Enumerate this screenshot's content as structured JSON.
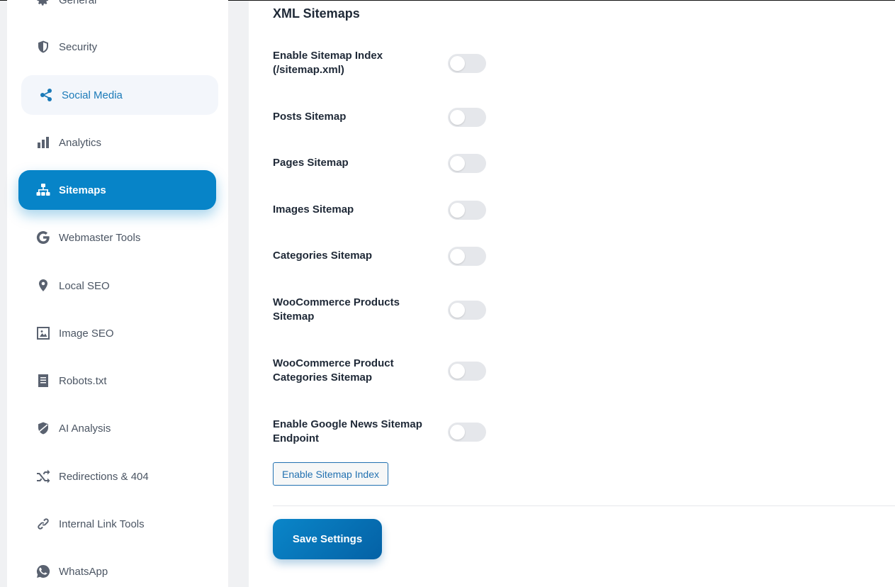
{
  "sidebar": {
    "items": [
      {
        "label": "General",
        "icon": "gear-icon",
        "state": "normal"
      },
      {
        "label": "Security",
        "icon": "shield-icon",
        "state": "normal"
      },
      {
        "label": "Social Media",
        "icon": "share-icon",
        "state": "hover"
      },
      {
        "label": "Analytics",
        "icon": "bar-chart-icon",
        "state": "normal"
      },
      {
        "label": "Sitemaps",
        "icon": "sitemap-icon",
        "state": "active"
      },
      {
        "label": "Webmaster Tools",
        "icon": "google-icon",
        "state": "normal"
      },
      {
        "label": "Local SEO",
        "icon": "map-pin-icon",
        "state": "normal"
      },
      {
        "label": "Image SEO",
        "icon": "image-icon",
        "state": "normal"
      },
      {
        "label": "Robots.txt",
        "icon": "document-icon",
        "state": "normal"
      },
      {
        "label": "AI Analysis",
        "icon": "ai-shield-icon",
        "state": "normal"
      },
      {
        "label": "Redirections & 404",
        "icon": "shuffle-icon",
        "state": "normal"
      },
      {
        "label": "Internal Link Tools",
        "icon": "link-icon",
        "state": "normal"
      },
      {
        "label": "WhatsApp",
        "icon": "whatsapp-icon",
        "state": "normal"
      }
    ]
  },
  "main": {
    "title": "XML Sitemaps",
    "settings": [
      {
        "label_line1": "Enable Sitemap Index",
        "label_line2": "(/sitemap.xml)",
        "enabled": false
      },
      {
        "label_line1": "Posts Sitemap",
        "label_line2": "",
        "enabled": false
      },
      {
        "label_line1": "Pages Sitemap",
        "label_line2": "",
        "enabled": false
      },
      {
        "label_line1": "Images Sitemap",
        "label_line2": "",
        "enabled": false
      },
      {
        "label_line1": "Categories Sitemap",
        "label_line2": "",
        "enabled": false
      },
      {
        "label_line1": "WooCommerce Products",
        "label_line2": "Sitemap",
        "enabled": false
      },
      {
        "label_line1": "WooCommerce Product",
        "label_line2": "Categories Sitemap",
        "enabled": false
      },
      {
        "label_line1": "Enable Google News Sitemap",
        "label_line2": "Endpoint",
        "enabled": false
      }
    ],
    "enable_index_button": "Enable Sitemap Index",
    "save_button": "Save Settings"
  },
  "colors": {
    "accent": "#0784c8",
    "hover_text": "#1b7ab8",
    "toggle_off": "#e5e7eb"
  }
}
